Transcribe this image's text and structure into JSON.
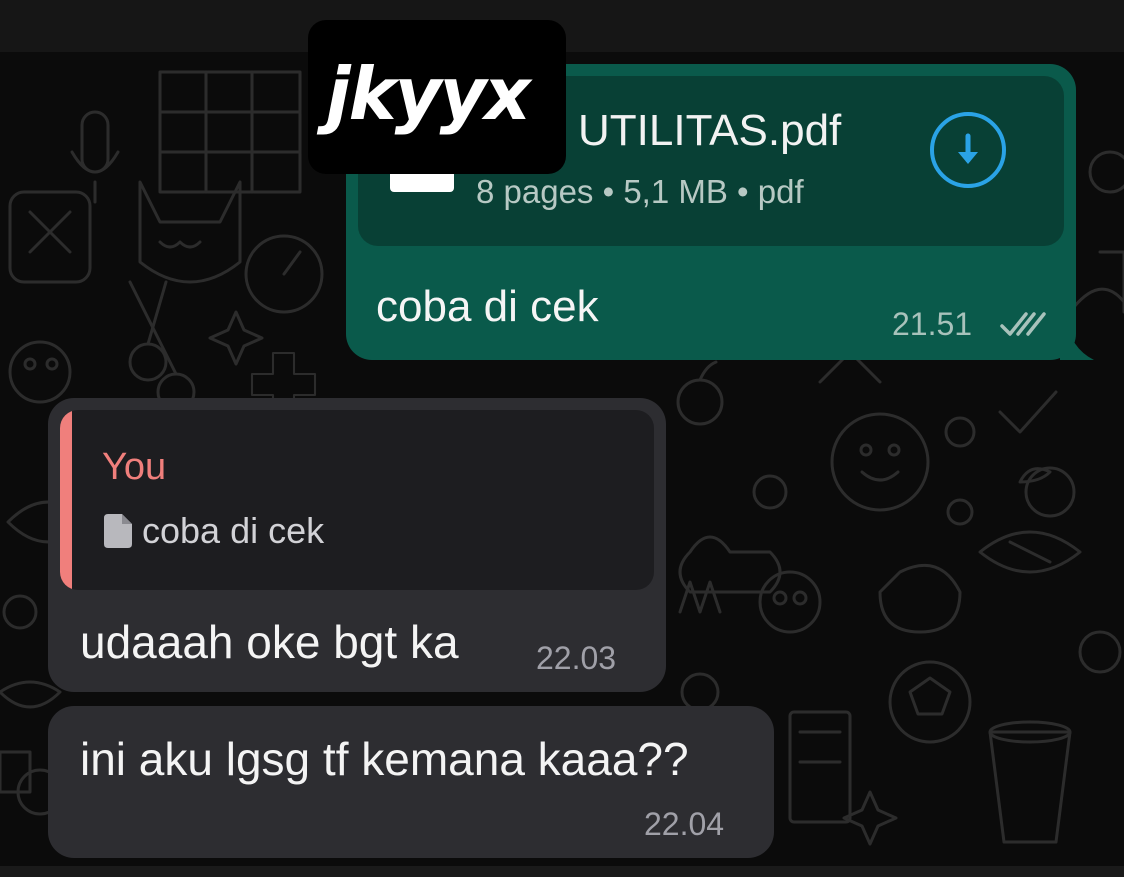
{
  "logo": {
    "text": "jkyyx"
  },
  "outgoing_message": {
    "document": {
      "name": "UTILITAS.pdf",
      "meta": "8 pages • 5,1 MB • pdf",
      "icon": "download-icon",
      "accent_color": "#2aa3e6"
    },
    "text": "coba di cek",
    "time": "21.51",
    "status_icon": "double-check-icon",
    "bubble_color": "#0a5a4b"
  },
  "incoming_messages": [
    {
      "reply_quote": {
        "author": "You",
        "icon": "document-icon",
        "text": "coba di cek",
        "accent_color": "#f07f7c"
      },
      "text": "udaaah oke bgt ka",
      "time": "22.03"
    },
    {
      "text": "ini aku lgsg tf kemana kaaa??",
      "time": "22.04"
    }
  ],
  "colors": {
    "background": "#0b0b0b",
    "incoming_bubble": "#2d2d31"
  }
}
